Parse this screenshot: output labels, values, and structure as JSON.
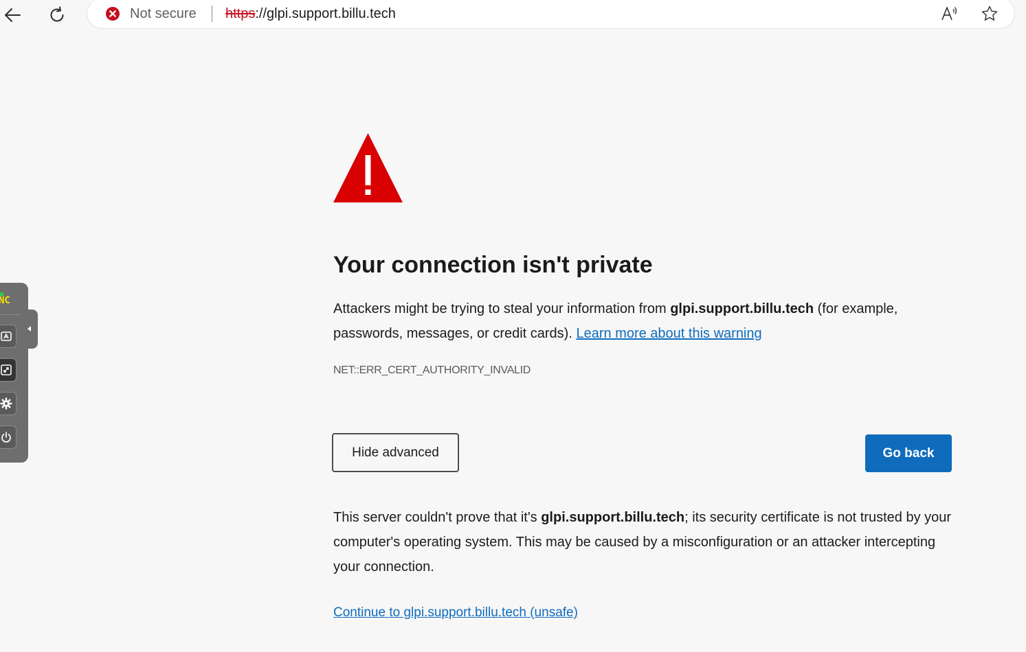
{
  "browser": {
    "security_label": "Not secure",
    "url_scheme": "https",
    "url_rest": "://glpi.support.billu.tech",
    "icons": {
      "back": "arrow-left-icon",
      "reload": "reload-icon",
      "security": "error-x-circle-icon",
      "read_aloud": "read-aloud-icon",
      "favorite": "star-icon"
    },
    "colors": {
      "security_red": "#c50f1f",
      "accent_blue": "#0f6cbd"
    }
  },
  "vnc_panel": {
    "logo_text": "NC",
    "buttons": [
      "keyboard-icon",
      "fullscreen-icon",
      "settings-icon",
      "power-icon"
    ]
  },
  "page": {
    "title": "Your connection isn't private",
    "desc_part1": "Attackers might be trying to steal your information from ",
    "desc_host": "glpi.support.billu.tech",
    "desc_part2": " (for example, passwords, messages, or credit cards). ",
    "learn_more": "Learn more about this warning",
    "error_code": "NET::ERR_CERT_AUTHORITY_INVALID",
    "hide_advanced": "Hide advanced",
    "go_back": "Go back",
    "details_part1": "This server couldn't prove that it's ",
    "details_host": "glpi.support.billu.tech",
    "details_part2": "; its security certificate is not trusted by your computer's operating system. This may be caused by a misconfiguration or an attacker intercepting your connection.",
    "continue_link": "Continue to glpi.support.billu.tech (unsafe)"
  }
}
